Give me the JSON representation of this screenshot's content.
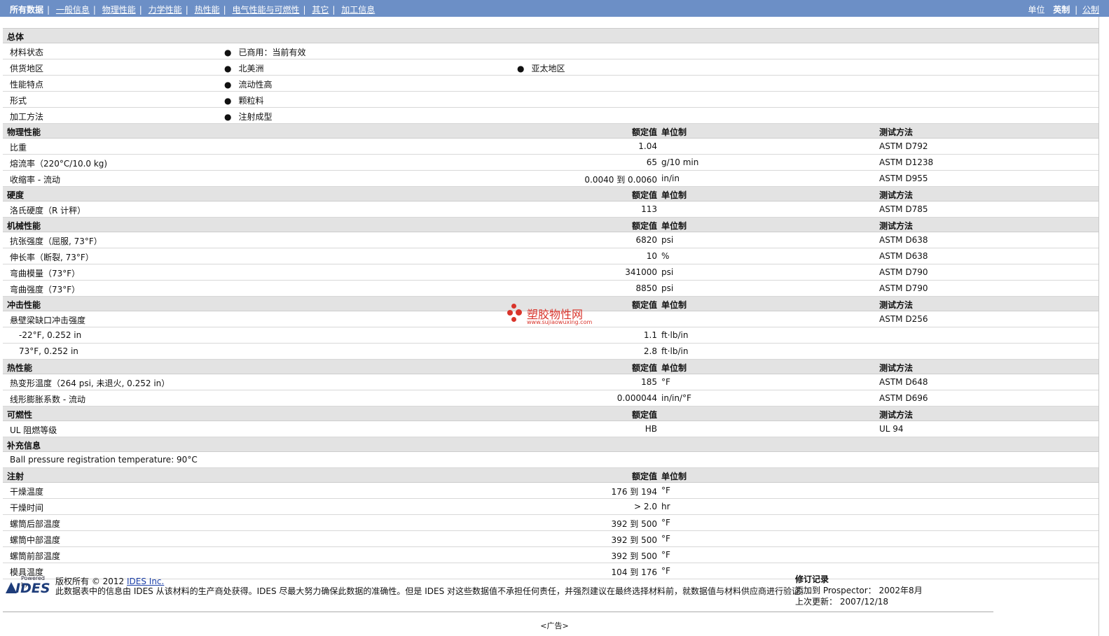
{
  "nav": {
    "items": [
      "所有数据",
      "一般信息",
      "物理性能",
      "力学性能",
      "热性能",
      "电气性能与可燃性",
      "其它",
      "加工信息"
    ],
    "units_label": "单位",
    "units": [
      "英制",
      "公制"
    ]
  },
  "general": {
    "title": "总体",
    "rows": [
      {
        "label": "材料状态",
        "v1": "已商用：当前有效",
        "v2": ""
      },
      {
        "label": "供货地区",
        "v1": "北美洲",
        "v2": "亚太地区"
      },
      {
        "label": "性能特点",
        "v1": "流动性高",
        "v2": ""
      },
      {
        "label": "形式",
        "v1": "颗粒料",
        "v2": ""
      },
      {
        "label": "加工方法",
        "v1": "注射成型",
        "v2": ""
      }
    ],
    "bullet": "●"
  },
  "headers": {
    "value": "额定值",
    "unit": "单位制",
    "method": "测试方法"
  },
  "sections": [
    {
      "title": "物理性能",
      "show_unit": true,
      "show_method": true,
      "rows": [
        {
          "label": "比重",
          "value": "1.04",
          "unit": "",
          "method": "ASTM D792"
        },
        {
          "label": "熔流率（220°C/10.0 kg)",
          "value": "65",
          "unit": "g/10 min",
          "method": "ASTM D1238"
        },
        {
          "label": "收缩率 - 流动",
          "value": "0.0040 到  0.0060",
          "unit": "in/in",
          "method": "ASTM D955"
        }
      ]
    },
    {
      "title": "硬度",
      "show_unit": true,
      "show_method": true,
      "rows": [
        {
          "label": "洛氏硬度（R 计秤）",
          "value": "113",
          "unit": "",
          "method": "ASTM D785"
        }
      ]
    },
    {
      "title": "机械性能",
      "show_unit": true,
      "show_method": true,
      "rows": [
        {
          "label": "抗张强度（屈服, 73°F）",
          "value": "6820",
          "unit": "psi",
          "method": "ASTM D638"
        },
        {
          "label": "伸长率（断裂, 73°F）",
          "value": "10",
          "unit": "%",
          "method": "ASTM D638"
        },
        {
          "label": "弯曲模量（73°F）",
          "value": "341000",
          "unit": "psi",
          "method": "ASTM D790"
        },
        {
          "label": "弯曲强度（73°F）",
          "value": "8850",
          "unit": "psi",
          "method": "ASTM D790"
        }
      ]
    },
    {
      "title": "冲击性能",
      "show_unit": true,
      "show_method": true,
      "rows": [
        {
          "label": "悬壁梁缺口冲击强度",
          "value": "",
          "unit": "",
          "method": "ASTM D256"
        },
        {
          "label": "-22°F, 0.252 in",
          "value": "1.1",
          "unit": "ft·lb/in",
          "method": "",
          "sub": true
        },
        {
          "label": "73°F, 0.252 in",
          "value": "2.8",
          "unit": "ft·lb/in",
          "method": "",
          "sub": true
        }
      ]
    },
    {
      "title": "热性能",
      "show_unit": true,
      "show_method": true,
      "rows": [
        {
          "label": "热变形温度（264 psi, 未退火, 0.252 in）",
          "value": "185",
          "unit": "°F",
          "method": "ASTM D648"
        },
        {
          "label": "线形膨胀系数 - 流动",
          "value": "0.000044",
          "unit": "in/in/°F",
          "method": "ASTM D696"
        }
      ]
    },
    {
      "title": "可燃性",
      "show_unit": false,
      "show_method": true,
      "rows": [
        {
          "label": "UL 阻燃等级",
          "value": "HB",
          "unit": "",
          "method": "UL 94"
        }
      ]
    },
    {
      "title": "补充信息",
      "show_value": false,
      "show_unit": false,
      "show_method": false,
      "rows": [
        {
          "label": "Ball pressure registration temperature: 90°C",
          "value": "",
          "unit": "",
          "method": ""
        }
      ]
    },
    {
      "title": "注射",
      "show_unit": true,
      "show_method": false,
      "rows": [
        {
          "label": "干燥温度",
          "value": "176 到  194",
          "unit": "°F",
          "method": ""
        },
        {
          "label": "干燥时间",
          "value": "> 2.0",
          "unit": "hr",
          "method": ""
        },
        {
          "label": "螺筒后部温度",
          "value": "392 到  500",
          "unit": "°F",
          "method": ""
        },
        {
          "label": "螺筒中部温度",
          "value": "392 到  500",
          "unit": "°F",
          "method": ""
        },
        {
          "label": "螺筒前部温度",
          "value": "392 到  500",
          "unit": "°F",
          "method": ""
        },
        {
          "label": "模具温度",
          "value": "104 到  176",
          "unit": "°F",
          "method": ""
        }
      ]
    }
  ],
  "watermark": {
    "name": "塑胶物性网",
    "url": "www.sujiaowuxing.com"
  },
  "footer": {
    "logo_powered": "Powered by",
    "logo_text": "IDES",
    "copyright_prefix": "版权所有 © 2012 ",
    "copyright_link": "IDES Inc.",
    "disclaimer": "此数据表中的信息由 IDES 从该材料的生产商处获得。IDES 尽最大努力确保此数据的准确性。但是 IDES 对这些数据值不承担任何责任，并强烈建议在最终选择材料前，就数据值与材料供应商进行验证。",
    "revision_title": "修订记录",
    "added_label": "添加到 Prospector：",
    "added_value": "2002年8月",
    "updated_label": "上次更新：",
    "updated_value": "2007/12/18"
  },
  "ad": "<广告>"
}
